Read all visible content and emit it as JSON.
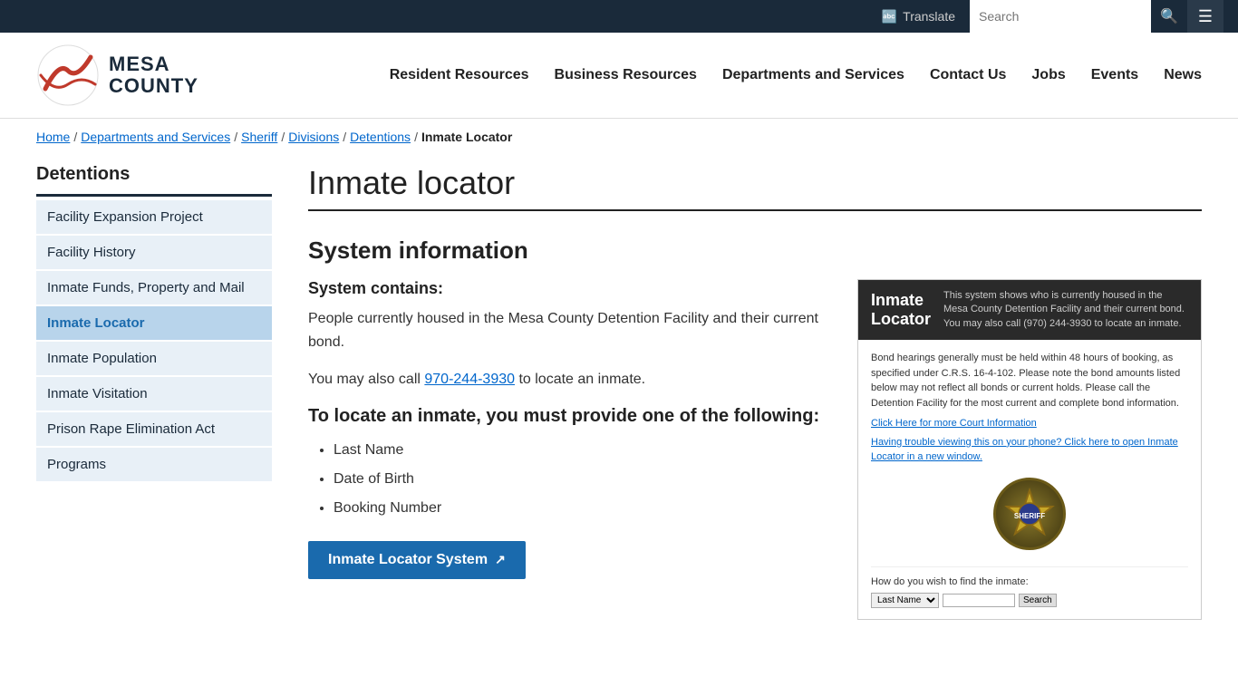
{
  "topbar": {
    "translate_label": "Translate",
    "search_placeholder": "Search",
    "search_icon": "🔍"
  },
  "header": {
    "logo_text_line1": "MESA",
    "logo_text_line2": "COUNTY",
    "nav_items": [
      {
        "label": "Resident Resources",
        "id": "resident-resources"
      },
      {
        "label": "Business Resources",
        "id": "business-resources"
      },
      {
        "label": "Departments and Services",
        "id": "departments-services"
      },
      {
        "label": "Contact Us",
        "id": "contact-us"
      },
      {
        "label": "Jobs",
        "id": "jobs"
      },
      {
        "label": "Events",
        "id": "events"
      },
      {
        "label": "News",
        "id": "news"
      }
    ]
  },
  "breadcrumb": {
    "items": [
      {
        "label": "Home",
        "link": true
      },
      {
        "label": "Departments and Services",
        "link": true
      },
      {
        "label": "Sheriff",
        "link": true
      },
      {
        "label": "Divisions",
        "link": true
      },
      {
        "label": "Detentions",
        "link": true
      },
      {
        "label": "Inmate Locator",
        "link": false
      }
    ]
  },
  "sidebar": {
    "title": "Detentions",
    "items": [
      {
        "label": "Facility Expansion Project",
        "active": false
      },
      {
        "label": "Facility History",
        "active": false
      },
      {
        "label": "Inmate Funds, Property and Mail",
        "active": false
      },
      {
        "label": "Inmate Locator",
        "active": true
      },
      {
        "label": "Inmate Population",
        "active": false
      },
      {
        "label": "Inmate Visitation",
        "active": false
      },
      {
        "label": "Prison Rape Elimination Act",
        "active": false
      },
      {
        "label": "Programs",
        "active": false
      }
    ]
  },
  "main": {
    "page_title": "Inmate locator",
    "section_title": "System information",
    "system_contains_label": "System contains:",
    "body_text_1": "People currently housed in the Mesa County Detention Facility and their current bond.",
    "body_text_2_prefix": "You may also call ",
    "phone": "970-244-3930",
    "body_text_2_suffix": " to locate an inmate.",
    "locate_title": "To locate an inmate, you must provide one of the following:",
    "bullet_items": [
      "Last Name",
      "Date of Birth",
      "Booking Number"
    ],
    "cta_button_label": "Inmate Locator System",
    "preview": {
      "header_title": "Inmate Locator",
      "header_text": "This system shows who is currently housed in the Mesa County Detention Facility and their current bond. You may also call (970) 244-3930 to locate an inmate.",
      "body_text": "Bond hearings generally must be held within 48 hours of booking, as specified under C.R.S. 16-4-102. Please note the bond amounts listed below may not reflect all bonds or current holds. Please call the Detention Facility for the most current and complete bond information.",
      "link1": "Click Here for more Court Information",
      "link2": "Having trouble viewing this on your phone? Click here to open Inmate Locator in a new window.",
      "search_label": "How do you wish to find the inmate:",
      "search_option": "Last Name",
      "search_btn": "Search"
    }
  }
}
